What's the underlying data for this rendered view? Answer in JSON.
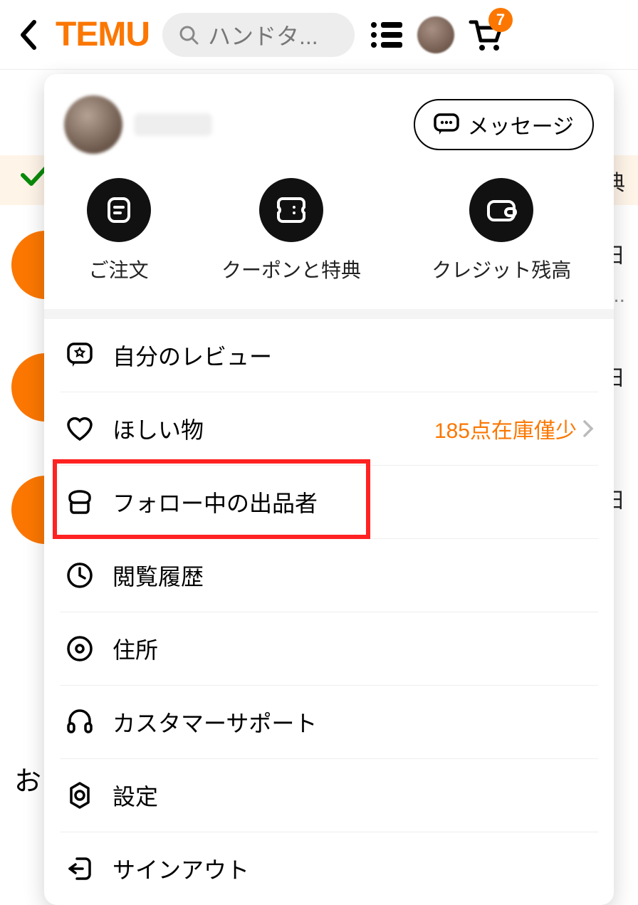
{
  "header": {
    "logo": "TEMU",
    "search_placeholder": "ハンドタ...",
    "cart_badge": "7"
  },
  "background": {
    "banner_text": "典",
    "row1_text": "日",
    "row1_dots": "..",
    "row2_text": "日",
    "row3_text": "日",
    "left_text": "お"
  },
  "popover": {
    "message_button": "メッセージ",
    "quick": [
      {
        "label": "ご注文"
      },
      {
        "label": "クーポンと特典"
      },
      {
        "label": "クレジット残高"
      }
    ],
    "menu": [
      {
        "label": "自分のレビュー",
        "right": ""
      },
      {
        "label": "ほしい物",
        "right": "185点在庫僅少"
      },
      {
        "label": "フォロー中の出品者",
        "right": ""
      },
      {
        "label": "閲覧履歴",
        "right": ""
      },
      {
        "label": "住所",
        "right": ""
      },
      {
        "label": "カスタマーサポート",
        "right": ""
      },
      {
        "label": "設定",
        "right": ""
      },
      {
        "label": "サインアウト",
        "right": ""
      }
    ]
  }
}
